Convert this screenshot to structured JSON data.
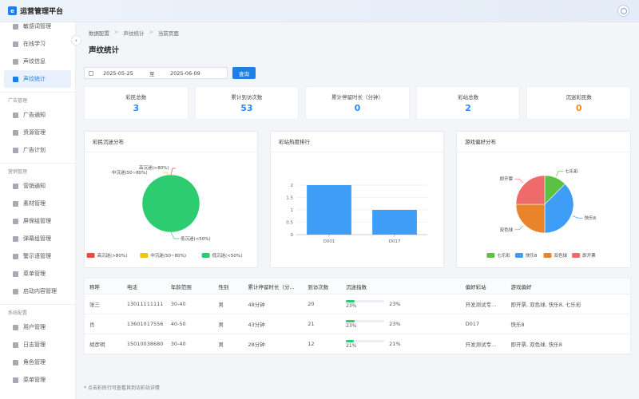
{
  "app": {
    "title": "运营管理平台",
    "logo_glyph": "e"
  },
  "sidebar": {
    "top_items": [
      {
        "label": "敏感词管理"
      },
      {
        "label": "在线学习"
      },
      {
        "label": "声纹信息"
      },
      {
        "label": "声纹统计",
        "active": true
      }
    ],
    "groups": [
      {
        "title": "广告管理",
        "items": [
          {
            "label": "广告通知"
          },
          {
            "label": "资源管理"
          },
          {
            "label": "广告计划"
          }
        ]
      },
      {
        "title": "营销管理",
        "items": [
          {
            "label": "营销通知"
          },
          {
            "label": "素材管理"
          },
          {
            "label": "屏保组管理"
          },
          {
            "label": "弹幕组管理"
          },
          {
            "label": "警示语管理"
          },
          {
            "label": "菜单管理"
          },
          {
            "label": "启动内容管理"
          }
        ]
      },
      {
        "title": "系统配置",
        "items": [
          {
            "label": "用户管理"
          },
          {
            "label": "日志管理"
          },
          {
            "label": "角色管理"
          },
          {
            "label": "菜单管理"
          }
        ]
      }
    ]
  },
  "breadcrumb": {
    "items": [
      "数据配置",
      "声纹统计",
      "当前页面"
    ],
    "separator": ">"
  },
  "page_title": "声纹统计",
  "filter": {
    "start_date": "2025-05-25",
    "to_label": "至",
    "end_date": "2025-06-09",
    "query_label": "查询"
  },
  "stats": [
    {
      "label": "彩民总数",
      "value": "3"
    },
    {
      "label": "累计到访次数",
      "value": "53"
    },
    {
      "label": "累计停留时长（分钟）",
      "value": "0"
    },
    {
      "label": "彩站总数",
      "value": "2"
    },
    {
      "label": "沉迷彩民数",
      "value": "0",
      "color": "#f08c1e"
    }
  ],
  "panels": {
    "addiction": {
      "title": "彩民沉迷分布"
    },
    "ranking": {
      "title": "彩站热度排行"
    },
    "preference": {
      "title": "游戏偏好分布"
    }
  },
  "chart_data": [
    {
      "type": "pie",
      "title": "彩民沉迷分布",
      "labels": [
        "高沉迷(>80%)",
        "中沉迷(50~80%)",
        "低沉迷(<50%)"
      ],
      "values": [
        0,
        0,
        3
      ],
      "colors": [
        "#e74c3c",
        "#f1c40f",
        "#2ecc71"
      ],
      "legend": "bottom"
    },
    {
      "type": "bar",
      "title": "彩站热度排行",
      "categories": [
        "D001",
        "D017"
      ],
      "values": [
        2,
        1
      ],
      "ylim": [
        0,
        2
      ],
      "yticks": [
        "0",
        "0.5",
        "1",
        "1.5",
        "2"
      ],
      "color": "#3d9df7"
    },
    {
      "type": "pie",
      "title": "游戏偏好分布",
      "labels": [
        "七乐彩",
        "快乐8",
        "双色球",
        "即开票"
      ],
      "values": [
        1,
        3,
        2,
        2
      ],
      "colors": [
        "#5cc043",
        "#3d9df7",
        "#e8842a",
        "#ef6a6a"
      ],
      "legend": "bottom"
    }
  ],
  "table": {
    "headers": [
      "称呼",
      "电话",
      "年龄范围",
      "性别",
      "累计停留时长（分...",
      "到访次数",
      "沉迷指数",
      "偏好彩站",
      "游戏偏好"
    ],
    "rows": [
      {
        "name": "张三",
        "phone": "13011111111",
        "age": "30-40",
        "gender": "男",
        "duration": "48分钟",
        "visits": "20",
        "index_label": "23%",
        "index_value": 23,
        "index_text": "23%",
        "station": "开发测试专...",
        "games": "即开票, 双色球, 快乐8, 七乐彩"
      },
      {
        "name": "肖",
        "phone": "13601017556",
        "age": "40-50",
        "gender": "男",
        "duration": "43分钟",
        "visits": "21",
        "index_label": "23%",
        "index_value": 23,
        "index_text": "23%",
        "station": "D017",
        "games": "快乐8"
      },
      {
        "name": "胡彦明",
        "phone": "15010038680",
        "age": "30-40",
        "gender": "男",
        "duration": "28分钟",
        "visits": "12",
        "index_label": "21%",
        "index_value": 21,
        "index_text": "21%",
        "station": "开发测试专...",
        "games": "即开票, 双色球, 快乐8"
      }
    ]
  },
  "footnote": "* 点击彩民行可查看其到访彩站详情"
}
